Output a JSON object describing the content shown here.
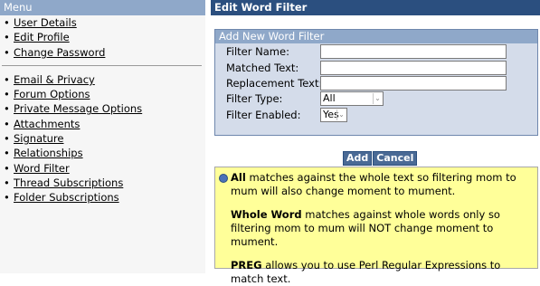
{
  "sidebar": {
    "title": "Menu",
    "group1": [
      {
        "label": "User Details"
      },
      {
        "label": "Edit Profile"
      },
      {
        "label": "Change Password"
      }
    ],
    "group2": [
      {
        "label": "Email & Privacy"
      },
      {
        "label": "Forum Options"
      },
      {
        "label": "Private Message Options"
      },
      {
        "label": "Attachments"
      },
      {
        "label": "Signature"
      },
      {
        "label": "Relationships"
      },
      {
        "label": "Word Filter"
      },
      {
        "label": "Thread Subscriptions"
      },
      {
        "label": "Folder Subscriptions"
      }
    ],
    "bullet": "•"
  },
  "main": {
    "title": "Edit Word Filter",
    "form": {
      "title": "Add New Word Filter",
      "filter_name_label": "Filter Name:",
      "filter_name_value": "",
      "matched_text_label": "Matched Text:",
      "matched_text_value": "",
      "replacement_text_label": "Replacement Text:",
      "replacement_text_value": "",
      "filter_type_label": "Filter Type:",
      "filter_type_value": "All",
      "filter_enabled_label": "Filter Enabled:",
      "filter_enabled_value": "Yes"
    },
    "buttons": {
      "add": "Add",
      "cancel": "Cancel"
    },
    "info": {
      "all_term": "All",
      "all_text": " matches against the whole text so filtering mom to mum will also change moment to mument.",
      "whole_term": "Whole Word",
      "whole_text": " matches against whole words only so filtering mom to mum will NOT change moment to mument.",
      "preg_term": "PREG",
      "preg_text": " allows you to use Perl Regular Expressions to match text."
    }
  },
  "colors": {
    "main_header_bg": "#2b4f7f",
    "sidebar_header_bg": "#8fa8c9",
    "form_bg": "#d4dcea",
    "info_bg": "#ffff99",
    "button_bg": "#4a6a95"
  }
}
